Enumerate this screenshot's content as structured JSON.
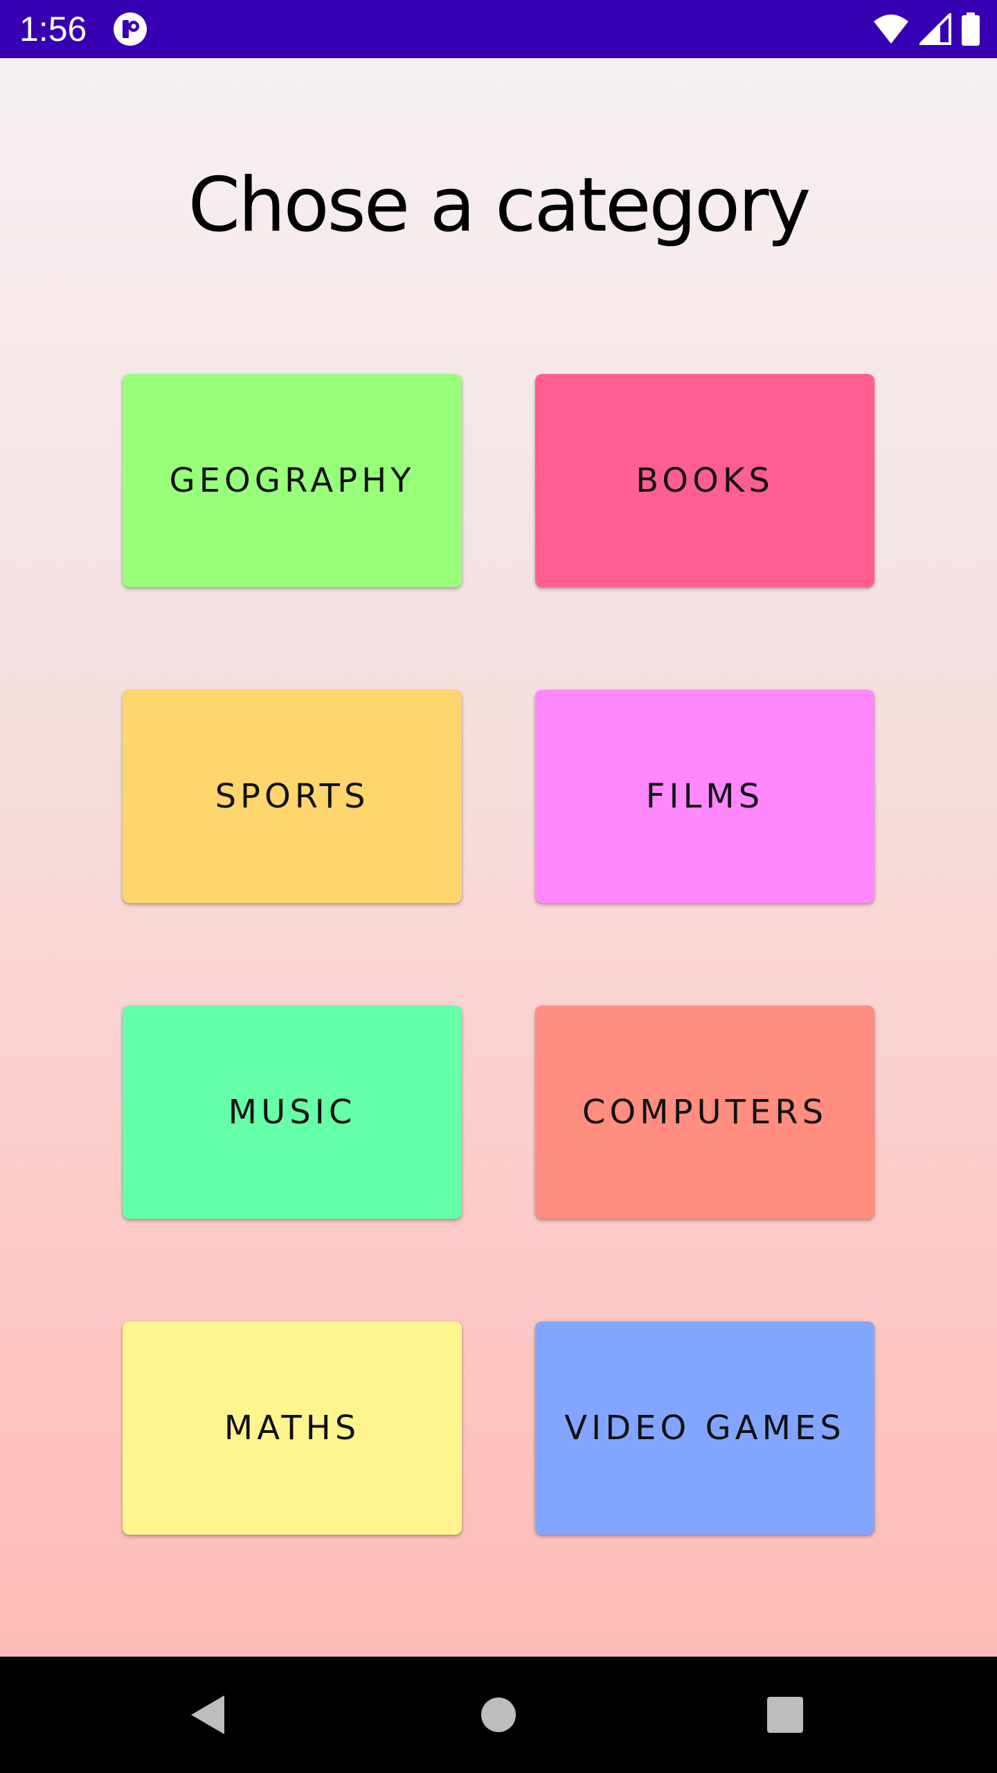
{
  "status_bar": {
    "time": "1:56",
    "background_color": "#3700B3",
    "icons": [
      "app-notification-icon",
      "wifi-icon",
      "cell-signal-icon",
      "battery-icon"
    ]
  },
  "main": {
    "title": "Chose a category",
    "categories": [
      {
        "label": "GEOGRAPHY",
        "color": "#98FF7A"
      },
      {
        "label": "BOOKS",
        "color": "#FF5E92"
      },
      {
        "label": "SPORTS",
        "color": "#FFD56E"
      },
      {
        "label": "FILMS",
        "color": "#FF88FF"
      },
      {
        "label": "MUSIC",
        "color": "#66FFA9"
      },
      {
        "label": "COMPUTERS",
        "color": "#FF8D80"
      },
      {
        "label": "MATHS",
        "color": "#FFF58F"
      },
      {
        "label": "VIDEO GAMES",
        "color": "#82A6FF"
      }
    ]
  },
  "nav_bar": {
    "icons": [
      "back-icon",
      "home-icon",
      "recents-icon"
    ]
  }
}
